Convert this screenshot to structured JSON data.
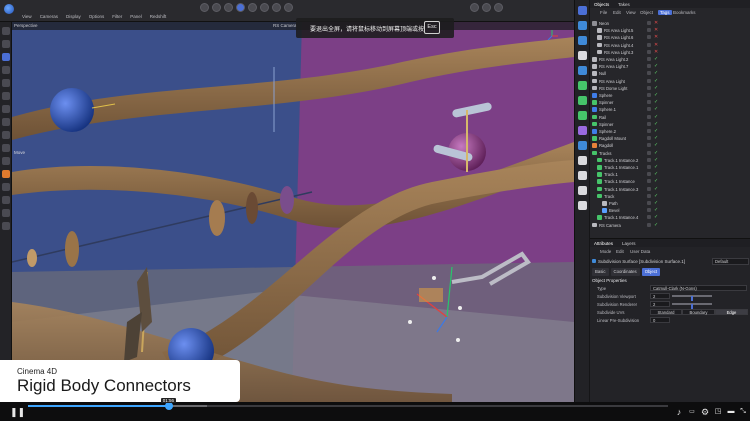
{
  "app": {
    "menu": [
      "View",
      "Cameras",
      "Display",
      "Options",
      "Filter",
      "Panel",
      "Redshift"
    ],
    "viewport_label": "Perspective",
    "camera_label": "RS Camera",
    "move_label": "Move"
  },
  "toast": {
    "message": "要退出全屏，请将鼠标移动到屏幕顶端或按",
    "key": "Esc"
  },
  "objects_panel": {
    "tabs": [
      "Objects",
      "Takes"
    ],
    "menu": [
      "File",
      "Edit",
      "View",
      "Object",
      "Tags",
      "Bookmarks"
    ],
    "active_menu": "Tags",
    "rows": [
      {
        "name": "Neon",
        "indent": 0,
        "color": "#8f8f96",
        "check": "x"
      },
      {
        "name": "RS Area Light.5",
        "indent": 1,
        "color": "#b9b9bf",
        "check": "x"
      },
      {
        "name": "RS Area Light.6",
        "indent": 1,
        "color": "#b9b9bf",
        "check": "x"
      },
      {
        "name": "RS Area Light.4",
        "indent": 1,
        "color": "#b9b9bf",
        "check": "x"
      },
      {
        "name": "RS Area Light.3",
        "indent": 1,
        "color": "#b9b9bf",
        "check": "x"
      },
      {
        "name": "RS Area Light.2",
        "indent": 0,
        "color": "#b9b9bf",
        "check": "ok"
      },
      {
        "name": "RS Area Light.7",
        "indent": 0,
        "color": "#b9b9bf",
        "check": "ok"
      },
      {
        "name": "Null",
        "indent": 0,
        "color": "#b9b9bf",
        "check": "ok"
      },
      {
        "name": "RS Area Light",
        "indent": 0,
        "color": "#b9b9bf",
        "check": "ok"
      },
      {
        "name": "RS Dome Light",
        "indent": 0,
        "color": "#b9b9bf",
        "check": "ok"
      },
      {
        "name": "Sphere",
        "indent": 0,
        "color": "#3f7de8",
        "check": "ok"
      },
      {
        "name": "Spinner",
        "indent": 0,
        "color": "#46c46a",
        "check": "ok"
      },
      {
        "name": "Sphere.1",
        "indent": 0,
        "color": "#3f7de8",
        "check": "ok"
      },
      {
        "name": "Rail",
        "indent": 0,
        "color": "#46c46a",
        "check": "ok"
      },
      {
        "name": "Spinner",
        "indent": 0,
        "color": "#46c46a",
        "check": "ok"
      },
      {
        "name": "Sphere.2",
        "indent": 0,
        "color": "#3f7de8",
        "check": "ok"
      },
      {
        "name": "Ragdoll Mount",
        "indent": 0,
        "color": "#46c46a",
        "check": "ok"
      },
      {
        "name": "Ragdoll",
        "indent": 0,
        "color": "#e8833a",
        "check": "ok"
      },
      {
        "name": "Tracks",
        "indent": 0,
        "color": "#46c46a",
        "check": "ok"
      },
      {
        "name": "Track.1 Instance.2",
        "indent": 1,
        "color": "#46c46a",
        "check": "ok"
      },
      {
        "name": "Track.1 Instance.1",
        "indent": 1,
        "color": "#46c46a",
        "check": "ok"
      },
      {
        "name": "Track.1",
        "indent": 1,
        "color": "#46c46a",
        "check": "ok"
      },
      {
        "name": "Track.1 Instance",
        "indent": 1,
        "color": "#46c46a",
        "check": "ok"
      },
      {
        "name": "Track.1 Instance.3",
        "indent": 1,
        "color": "#46c46a",
        "check": "ok"
      },
      {
        "name": "Track",
        "indent": 1,
        "color": "#46c46a",
        "check": "ok"
      },
      {
        "name": "Path",
        "indent": 2,
        "color": "#b9b9bf",
        "check": "ok"
      },
      {
        "name": "Bevel",
        "indent": 2,
        "color": "#5aa0ff",
        "check": "ok"
      },
      {
        "name": "Track.1 Instance.4",
        "indent": 1,
        "color": "#46c46a",
        "check": "ok"
      },
      {
        "name": "RS Camera",
        "indent": 0,
        "color": "#b9b9bf",
        "check": "ok"
      }
    ]
  },
  "attributes_panel": {
    "tabs": [
      "Attributes",
      "Layers"
    ],
    "menu": [
      "Mode",
      "Edit",
      "User Data"
    ],
    "object_title": "Subdivision Surface [Subdivision Surface.1]",
    "preset": "Default",
    "sub_tabs": [
      "Basic",
      "Coordinates",
      "Object"
    ],
    "active_sub_tab": "Object",
    "section": "Object Properties",
    "props": [
      {
        "label": "Type",
        "value": "Catmull-Clark (N-Gons)"
      },
      {
        "label": "Subdivision Viewport",
        "value": "2",
        "fraction": 0.5
      },
      {
        "label": "Subdivision Renderer",
        "value": "2",
        "fraction": 0.5
      },
      {
        "label": "Subdivide UVs",
        "options": [
          "Standard",
          "Boundary",
          "Edge"
        ],
        "selected": "Edge"
      },
      {
        "label": "Linear Pre-Subdivision",
        "value": "0"
      }
    ]
  },
  "caption": {
    "subtitle": "Cinema 4D",
    "title": "Rigid Body Connectors"
  },
  "player": {
    "progress": 0.22,
    "buffered": 0.28,
    "time_tip": "01:56"
  }
}
